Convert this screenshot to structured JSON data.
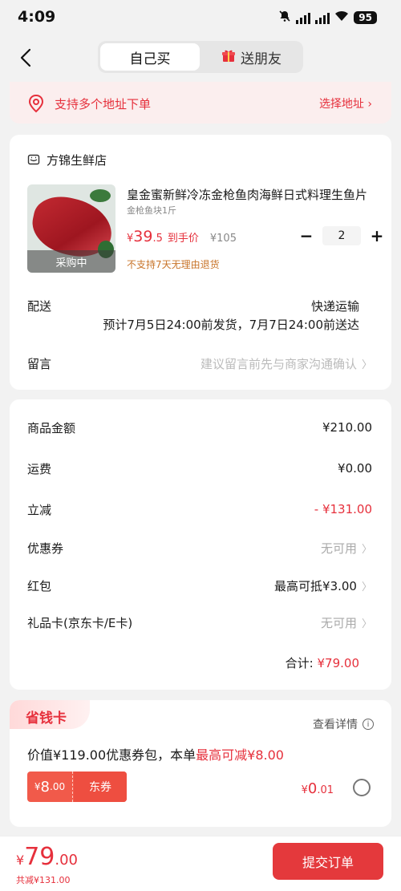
{
  "status": {
    "time": "4:09",
    "battery": "95"
  },
  "nav": {
    "tab_self": "自己买",
    "tab_gift": "送朋友"
  },
  "address": {
    "notice": "支持多个地址下单",
    "select_label": "选择地址 ›"
  },
  "order": {
    "shop_name": "方锦生鲜店",
    "product_title": "皇金蜜新鲜冷冻金枪鱼肉海鲜日式料理生鱼片",
    "product_spec": "金枪鱼块1斤",
    "image_badge": "采购中",
    "price_currency": "¥",
    "price_int": "39",
    "price_dec": ".5",
    "price_tag": "到手价",
    "price_original": "¥105",
    "quantity": "2",
    "qty_minus": "−",
    "qty_plus": "+",
    "no_return": "不支持7天无理由退货",
    "shipping_label": "配送",
    "shipping_method": "快递运输",
    "shipping_eta": "预计7月5日24:00前发货，7月7日24:00前送达",
    "message_label": "留言",
    "message_placeholder": "建议留言前先与商家沟通确认"
  },
  "summary": {
    "goods_label": "商品金额",
    "goods_value": "¥210.00",
    "freight_label": "运费",
    "freight_value": "¥0.00",
    "discount_label": "立减",
    "discount_value": "- ¥131.00",
    "coupon_label": "优惠券",
    "coupon_value": "无可用",
    "redpacket_label": "红包",
    "redpacket_value": "最高可抵¥3.00",
    "giftcard_label": "礼品卡(京东卡/E卡)",
    "giftcard_value": "无可用",
    "total_label": "合计:",
    "total_value": "¥79.00"
  },
  "saver": {
    "title": "省钱卡",
    "detail": "查看详情",
    "desc_prefix": "价值¥119.00优惠券包，本单",
    "desc_highlight": "最高可减¥8.00",
    "coupon_currency": "¥",
    "coupon_int": "8",
    "coupon_dec": ".00",
    "coupon_tag": "东券",
    "price_currency": "¥",
    "price_int": "0",
    "price_dec": ".01"
  },
  "bottom": {
    "currency": "¥",
    "price_int": "79",
    "price_dec": ".00",
    "saved": "共减¥131.00",
    "submit_label": "提交订单"
  },
  "colors": {
    "accent": "#e6303c",
    "submit": "#e4393c",
    "warning": "#c8742a",
    "bg": "#f2f2f2"
  }
}
